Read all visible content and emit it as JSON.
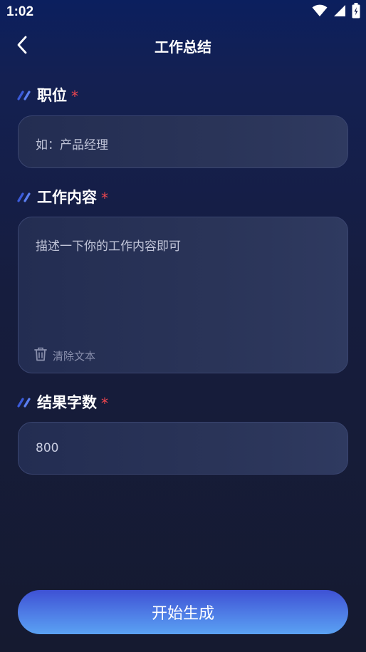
{
  "status_bar": {
    "time": "1:02",
    "icons": [
      "wifi-icon",
      "cellular-signal-icon",
      "battery-charging-icon"
    ]
  },
  "header": {
    "back_icon": "chevron-left-icon",
    "title": "工作总结"
  },
  "form": {
    "position": {
      "label": "职位",
      "required_mark": "*",
      "placeholder": "如：产品经理"
    },
    "content": {
      "label": "工作内容",
      "required_mark": "*",
      "placeholder": "描述一下你的工作内容即可",
      "clear_label": "清除文本",
      "clear_icon": "trash-icon"
    },
    "word_count": {
      "label": "结果字数",
      "required_mark": "*",
      "value": "800"
    }
  },
  "actions": {
    "generate_label": "开始生成"
  },
  "colors": {
    "required": "#f0474f",
    "accent_start": "#3e51d4",
    "accent_end": "#5aa2f3",
    "label_deco": "#3b5bdb"
  }
}
